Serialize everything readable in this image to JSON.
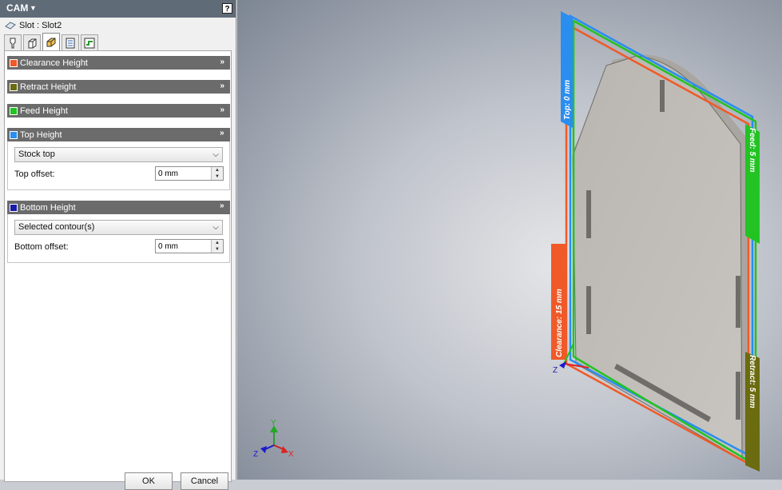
{
  "panel": {
    "title": "CAM",
    "help_label": "?",
    "operation_name": "Slot : Slot2",
    "tabs": [
      {
        "name": "tool",
        "icon": "tool-icon"
      },
      {
        "name": "geometry",
        "icon": "geometry-icon"
      },
      {
        "name": "heights",
        "icon": "heights-icon"
      },
      {
        "name": "passes",
        "icon": "passes-icon"
      },
      {
        "name": "linking",
        "icon": "linking-icon"
      }
    ],
    "groups": {
      "clearance": {
        "label": "Clearance Height",
        "color": "#f05a28"
      },
      "retract": {
        "label": "Retract Height",
        "color": "#6b6b10"
      },
      "feed": {
        "label": "Feed Height",
        "color": "#22c322"
      },
      "top": {
        "label": "Top Height",
        "color": "#2a8df0",
        "from": "Stock top",
        "offset_label": "Top offset:",
        "offset_value": "0 mm"
      },
      "bottom": {
        "label": "Bottom Height",
        "color": "#1a1aa8",
        "from": "Selected contour(s)",
        "offset_label": "Bottom offset:",
        "offset_value": "0 mm"
      }
    },
    "ok_label": "OK",
    "cancel_label": "Cancel"
  },
  "viewport": {
    "labels": {
      "top": "Top: 0 mm",
      "feed": "Feed: 5 mm",
      "clearance": "Clearance: 15 mm",
      "retract": "Retract: 5 mm"
    },
    "triad": {
      "x": "X",
      "y": "Y",
      "z": "Z"
    },
    "origin_triad": {
      "z": "Z"
    }
  }
}
